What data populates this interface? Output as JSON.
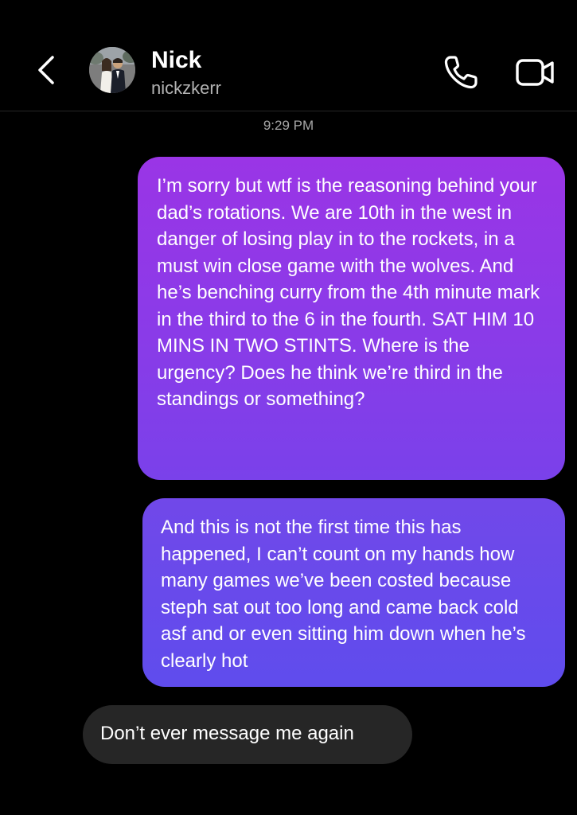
{
  "header": {
    "contact_name": "Nick",
    "contact_username": "nickzkerr"
  },
  "icons": {
    "back": "chevron-left-icon",
    "call": "phone-icon",
    "video": "video-camera-icon"
  },
  "conversation": {
    "timestamp": "9:29 PM",
    "messages": [
      {
        "sender": "me",
        "text": "I’m sorry but wtf is the reasoning behind your dad’s rotations. We are 10th in the west in danger of losing play in to the rockets, in a must win close game with the wolves. And he’s benching curry from the 4th minute mark in the third to the 6 in the fourth. SAT HIM 10 MINS IN TWO STINTS. Where is the urgency? Does he think we’re third in the standings or something?"
      },
      {
        "sender": "me",
        "text": "And this is not the first time this has happened, I can’t count on my hands how many games we’ve been costed because steph sat out too long and came back cold asf and or even sitting him down when he’s clearly hot"
      },
      {
        "sender": "Nick",
        "text": "Don’t ever message me again"
      }
    ]
  },
  "colors": {
    "background": "#000000",
    "sent_bubble_top": "#9a35e6",
    "sent_bubble_bottom": "#5f4ced",
    "received_bubble": "#262626",
    "secondary_text": "#b3b3b3"
  }
}
